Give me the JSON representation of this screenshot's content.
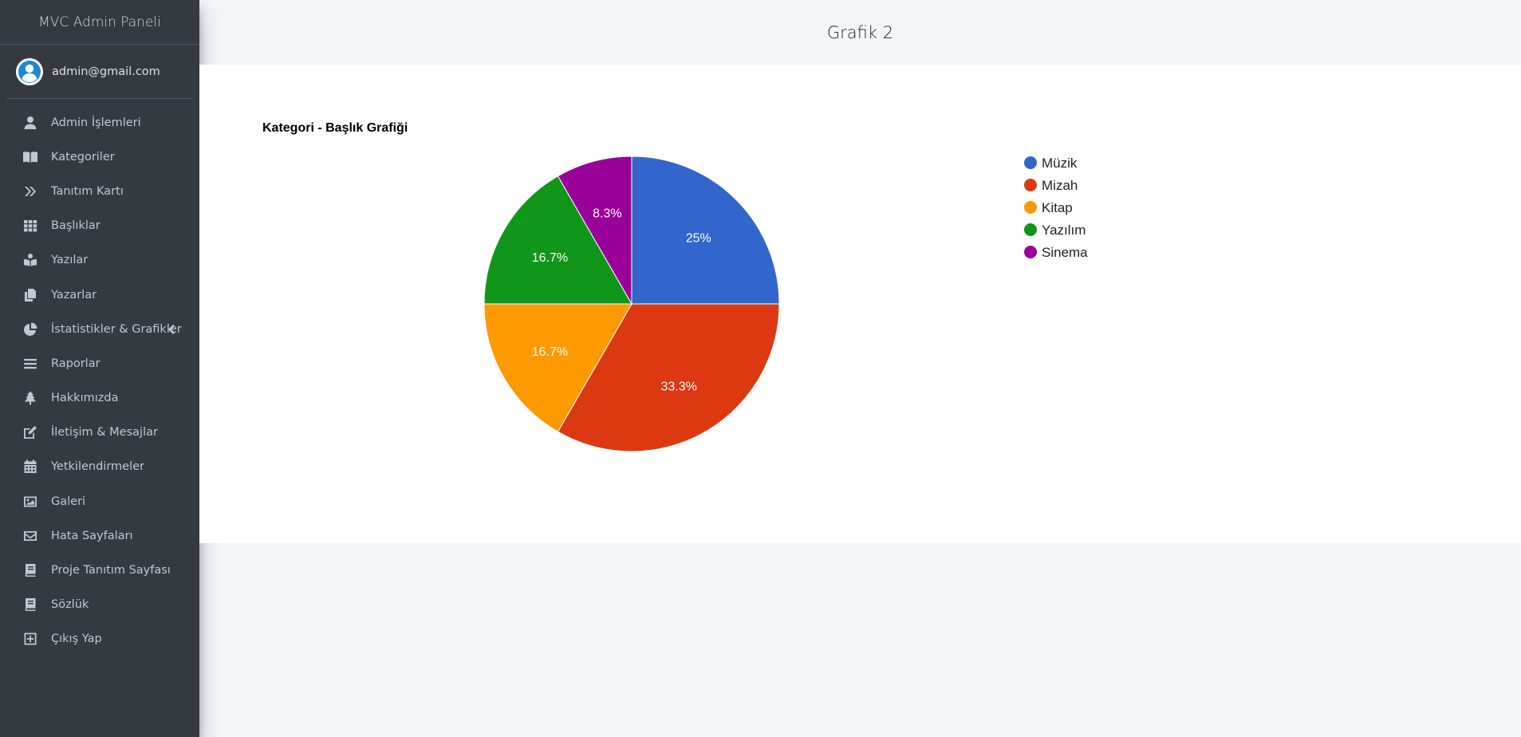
{
  "brand": {
    "title": "MVC Admin Paneli"
  },
  "user": {
    "email": "admin@gmail.com",
    "avatar_icon": "user-circle-icon"
  },
  "sidebar": {
    "items": [
      {
        "label": "Admin İşlemleri",
        "icon": "user-icon"
      },
      {
        "label": "Kategoriler",
        "icon": "book-open-icon"
      },
      {
        "label": "Tanıtım Kartı",
        "icon": "angle-double-right-icon"
      },
      {
        "label": "Başlıklar",
        "icon": "grid-icon"
      },
      {
        "label": "Yazılar",
        "icon": "book-reader-icon"
      },
      {
        "label": "Yazarlar",
        "icon": "copy-icon"
      },
      {
        "label": "İstatistikler & Grafikler",
        "icon": "chart-pie-icon",
        "expandable": true
      },
      {
        "label": "Raporlar",
        "icon": "bars-icon"
      },
      {
        "label": "Hakkımızda",
        "icon": "tree-icon"
      },
      {
        "label": "İletişim & Mesajlar",
        "icon": "edit-icon"
      },
      {
        "label": "Yetkilendirmeler",
        "icon": "calendar-icon"
      },
      {
        "label": "Galeri",
        "icon": "image-icon"
      },
      {
        "label": "Hata Sayfaları",
        "icon": "envelope-icon"
      },
      {
        "label": "Proje Tanıtım Sayfası",
        "icon": "book-icon"
      },
      {
        "label": "Sözlük",
        "icon": "book-icon"
      },
      {
        "label": "Çıkış Yap",
        "icon": "plus-square-icon"
      }
    ]
  },
  "header": {
    "title": "Grafik 2"
  },
  "chart_data": {
    "type": "pie",
    "title": "Kategori - Başlık Grafiği",
    "categories": [
      "Müzik",
      "Mizah",
      "Kitap",
      "Yazılım",
      "Sinema"
    ],
    "values": [
      3,
      4,
      2,
      2,
      1
    ],
    "labels": [
      "25%",
      "33.3%",
      "16.7%",
      "16.7%",
      "8.3%"
    ],
    "colors": [
      "#3366cc",
      "#dc3912",
      "#ff9900",
      "#109618",
      "#990099"
    ],
    "legend_position": "right"
  }
}
